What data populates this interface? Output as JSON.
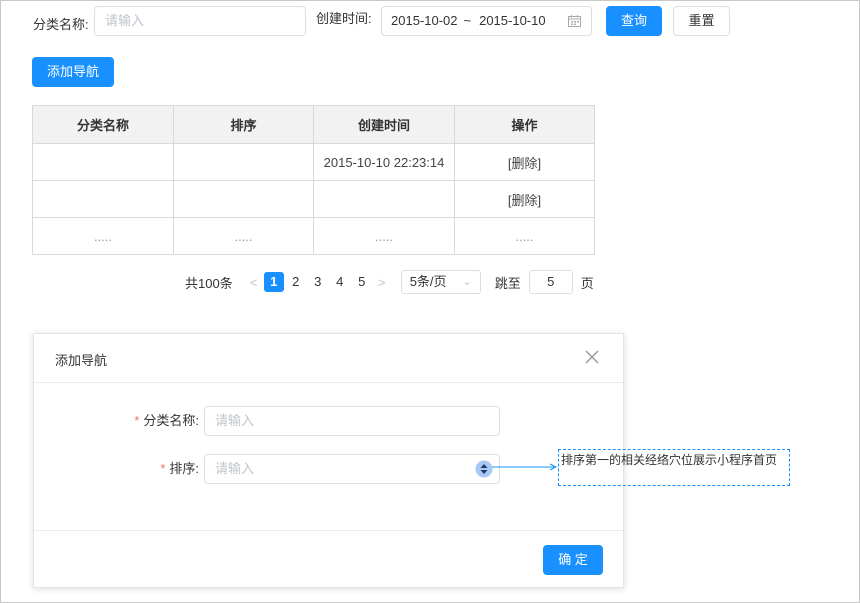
{
  "filter": {
    "category_label": "分类名称:",
    "category_placeholder": "请输入",
    "created_label": "创建时间:",
    "date_start": "2015-10-02",
    "date_sep": "~",
    "date_end": "2015-10-10",
    "query_button": "查询",
    "reset_button": "重置"
  },
  "add_nav_button": "添加导航",
  "table": {
    "headers": [
      "分类名称",
      "排序",
      "创建时间",
      "操作"
    ],
    "rows": [
      [
        "",
        "",
        "2015-10-10 22:23:14",
        "[删除]"
      ],
      [
        "",
        "",
        "",
        "[删除]"
      ],
      [
        ".....",
        ".....",
        ".....",
        "....."
      ]
    ]
  },
  "pagination": {
    "total": "共100条",
    "prev": "<",
    "pages": [
      "1",
      "2",
      "3",
      "4",
      "5"
    ],
    "next": ">",
    "page_size": "5条/页",
    "jump_label": "跳至",
    "jump_value": "5",
    "page_suffix": "页"
  },
  "dialog": {
    "title": "添加导航",
    "category_label": "分类名称:",
    "category_placeholder": "请输入",
    "sort_label": "排序:",
    "sort_placeholder": "请输入",
    "required_mark": "*",
    "confirm_button": "确 定"
  },
  "annotation": "排序第一的相关经络穴位展示小程序首页",
  "colors": {
    "primary": "#1890ff",
    "required": "#f56c6c",
    "table_header_bg": "#f2f2f2"
  },
  "icons": [
    "calendar-icon",
    "close-icon",
    "stepper-icon",
    "chevron-left-icon",
    "chevron-right-icon",
    "chevron-down-icon"
  ]
}
